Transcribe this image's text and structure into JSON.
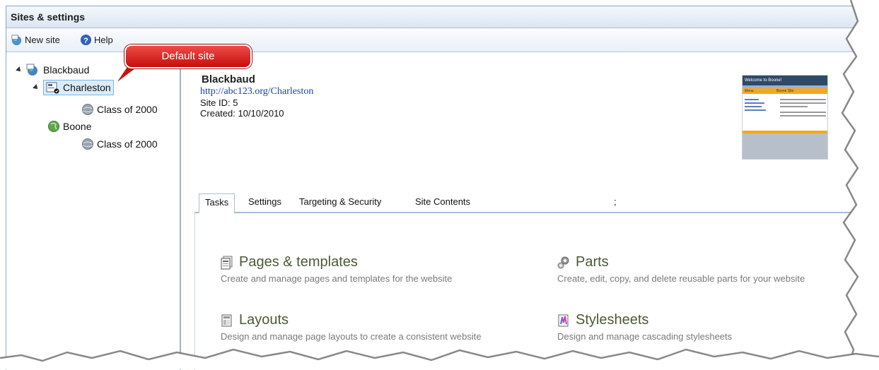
{
  "window": {
    "title": "Sites & settings"
  },
  "toolbar": {
    "new_site": "New site",
    "help": "Help"
  },
  "tree": {
    "root": "Blackbaud",
    "charleston": "Charleston",
    "charleston_child": "Class of 2000",
    "boone": "Boone",
    "boone_child": "Class of 2000"
  },
  "callout": {
    "text": "Default site"
  },
  "site": {
    "name": "Blackbaud",
    "url": "http://abc123.org/Charleston",
    "site_id": "Site ID: 5",
    "created": "Created: 10/10/2010"
  },
  "thumbnail": {
    "header": "Welcome to Boone!",
    "col1": "Menu",
    "col2": "Boone Site"
  },
  "tabs": [
    "Tasks",
    "Settings",
    "Targeting & Security",
    "Site Contents",
    ";"
  ],
  "tasks": [
    {
      "title": "Pages & templates",
      "desc": "Create and manage pages and templates for the website",
      "icon": "pages-icon"
    },
    {
      "title": "Parts",
      "desc": "Create, edit, copy, and delete reusable parts for your website",
      "icon": "parts-icon"
    },
    {
      "title": "Layouts",
      "desc": "Design and manage page layouts to create a consistent website",
      "icon": "layouts-icon"
    },
    {
      "title": "Stylesheets",
      "desc": "Design and manage cascading stylesheets",
      "icon": "stylesheets-icon"
    }
  ]
}
